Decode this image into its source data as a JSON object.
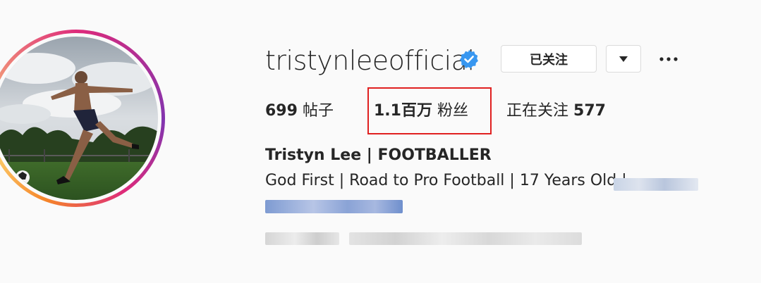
{
  "profile": {
    "username": "tristynleeofficial",
    "verified": true,
    "follow_label": "已关注",
    "dropdown_icon": "caret-down-icon",
    "more_icon": "more-horizontal-icon"
  },
  "stats": {
    "posts_count": "699",
    "posts_label": "帖子",
    "followers_count": "1.1百万",
    "followers_label": "粉丝",
    "following_label": "正在关注",
    "following_count": "577"
  },
  "bio": {
    "full_name": "Tristyn Lee | FOOTBALLER",
    "line1": "God First | Road to Pro Football | 17 Years Old |"
  },
  "colors": {
    "verified_badge": "#3897f0",
    "highlight_box": "#e02020",
    "text": "#262626",
    "background": "#fafafa"
  }
}
